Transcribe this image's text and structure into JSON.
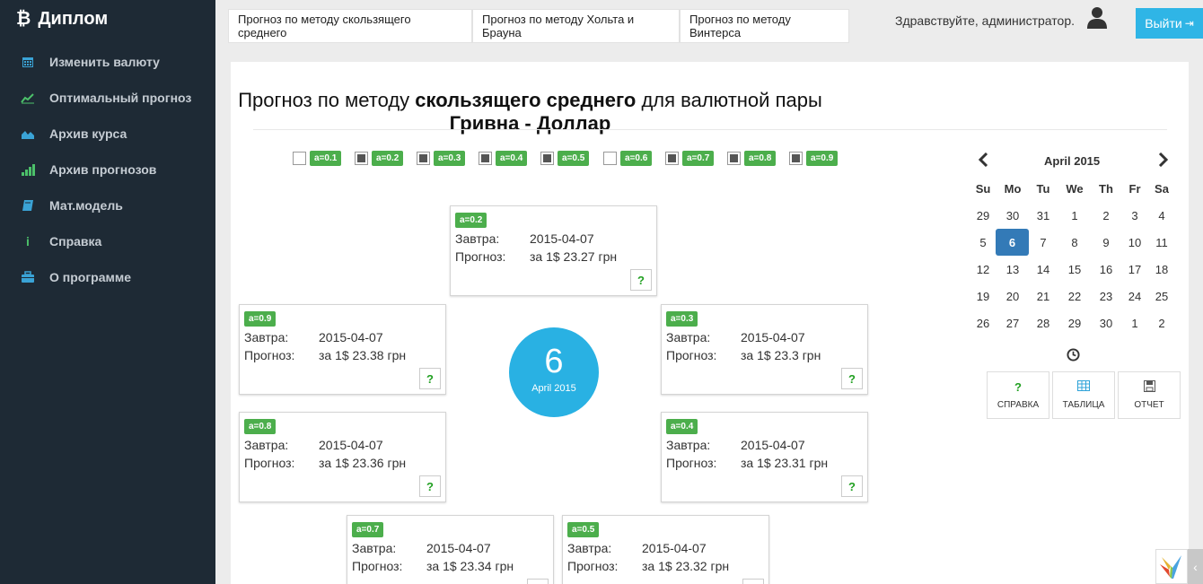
{
  "brand": {
    "title": "Диплом",
    "icon": "bitcoin-icon"
  },
  "sidebar": {
    "items": [
      {
        "label": "Изменить валюту",
        "icon": "calendar-icon"
      },
      {
        "label": "Оптимальный прогноз",
        "icon": "line-chart-icon"
      },
      {
        "label": "Архив курса",
        "icon": "area-chart-icon"
      },
      {
        "label": "Архив прогнозов",
        "icon": "signal-bars-icon"
      },
      {
        "label": "Мат.модель",
        "icon": "book-icon"
      },
      {
        "label": "Справка",
        "icon": "info-icon"
      },
      {
        "label": "О программе",
        "icon": "briefcase-icon"
      }
    ]
  },
  "tabs": [
    "Прогноз по методу скользящего среднего",
    "Прогноз по методу Хольта и Брауна",
    "Прогноз по методу Винтерса"
  ],
  "header": {
    "greeting": "Здравствуйте, администратор.",
    "logout_label": "Выйти"
  },
  "title": {
    "p1": "Прогноз по методу ",
    "b1": "скользящего среднего",
    "p2": " для валютной пары ",
    "b2": "Гривна - Доллар"
  },
  "alphas": [
    {
      "label": "a=0.1",
      "checked": false
    },
    {
      "label": "a=0.2",
      "checked": true
    },
    {
      "label": "a=0.3",
      "checked": true
    },
    {
      "label": "a=0.4",
      "checked": true
    },
    {
      "label": "a=0.5",
      "checked": true
    },
    {
      "label": "a=0.6",
      "checked": false
    },
    {
      "label": "a=0.7",
      "checked": true
    },
    {
      "label": "a=0.8",
      "checked": true
    },
    {
      "label": "a=0.9",
      "checked": true
    }
  ],
  "card_labels": {
    "tomorrow": "Завтра:",
    "forecast": "Прогноз:",
    "help": "?"
  },
  "cards": [
    {
      "badge": "a=0.2",
      "date": "2015-04-07",
      "forecast": "за 1$ 23.27 грн"
    },
    {
      "badge": "a=0.9",
      "date": "2015-04-07",
      "forecast": "за 1$ 23.38 грн"
    },
    {
      "badge": "a=0.3",
      "date": "2015-04-07",
      "forecast": "за 1$ 23.3 грн"
    },
    {
      "badge": "a=0.8",
      "date": "2015-04-07",
      "forecast": "за 1$ 23.36 грн"
    },
    {
      "badge": "a=0.4",
      "date": "2015-04-07",
      "forecast": "за 1$ 23.31 грн"
    },
    {
      "badge": "a=0.7",
      "date": "2015-04-07",
      "forecast": "за 1$ 23.34 грн"
    },
    {
      "badge": "a=0.5",
      "date": "2015-04-07",
      "forecast": "за 1$ 23.32 грн"
    }
  ],
  "center": {
    "day": "6",
    "month": "April 2015"
  },
  "calendar": {
    "month": "April 2015",
    "dow": [
      "Su",
      "Mo",
      "Tu",
      "We",
      "Th",
      "Fr",
      "Sa"
    ],
    "weeks": [
      [
        "29",
        "30",
        "31",
        "1",
        "2",
        "3",
        "4"
      ],
      [
        "5",
        "6",
        "7",
        "8",
        "9",
        "10",
        "11"
      ],
      [
        "12",
        "13",
        "14",
        "15",
        "16",
        "17",
        "18"
      ],
      [
        "19",
        "20",
        "21",
        "22",
        "23",
        "24",
        "25"
      ],
      [
        "26",
        "27",
        "28",
        "29",
        "30",
        "1",
        "2"
      ]
    ],
    "selected": "6"
  },
  "tools": [
    {
      "label": "СПРАВКА",
      "icon": "question-icon",
      "color": "#22a022"
    },
    {
      "label": "ТАБЛИЦА",
      "icon": "table-icon",
      "color": "#2fa3d8"
    },
    {
      "label": "ОТЧЕТ",
      "icon": "save-icon",
      "color": "#555555"
    }
  ]
}
